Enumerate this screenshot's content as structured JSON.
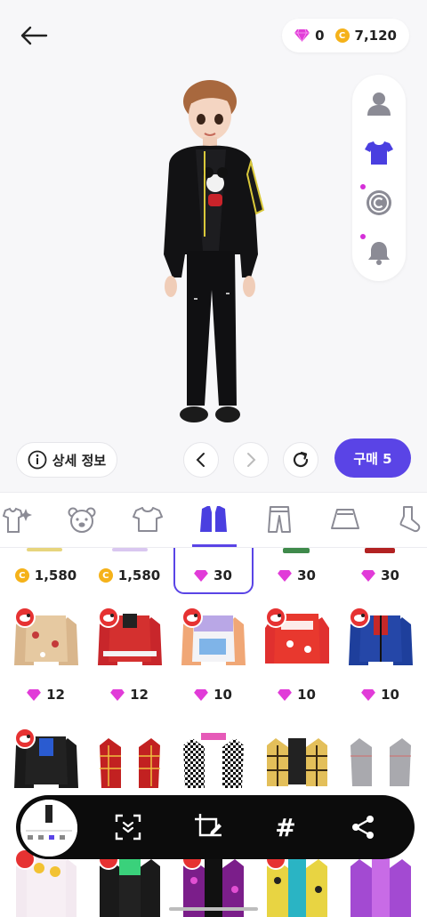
{
  "header": {
    "gem_count": "0",
    "coin_symbol": "C",
    "coin_count": "7,120"
  },
  "actions": {
    "detail_label": "상세 정보",
    "buy_label": "구매 5"
  },
  "categories": [
    {
      "name": "outfit-set-icon"
    },
    {
      "name": "bear-icon"
    },
    {
      "name": "tshirt-icon"
    },
    {
      "name": "jacket-icon",
      "selected": true
    },
    {
      "name": "pants-icon"
    },
    {
      "name": "skirt-icon"
    },
    {
      "name": "sock-icon"
    }
  ],
  "items_row1": [
    {
      "currency": "coin",
      "price": "1,580"
    },
    {
      "currency": "coin",
      "price": "1,580"
    },
    {
      "currency": "gem",
      "price": "30",
      "selected": true
    },
    {
      "currency": "gem",
      "price": "30"
    },
    {
      "currency": "gem",
      "price": "30"
    }
  ],
  "items_row2": [
    {
      "currency": "gem",
      "price": "12"
    },
    {
      "currency": "gem",
      "price": "12"
    },
    {
      "currency": "gem",
      "price": "10"
    },
    {
      "currency": "gem",
      "price": "10"
    },
    {
      "currency": "gem",
      "price": "10"
    }
  ],
  "toolbar": {
    "hashtag": "#"
  },
  "colors": {
    "accent": "#5a44e6",
    "gem": "#e13bd8",
    "coin": "#f5b21a",
    "badge": "#e63232"
  }
}
